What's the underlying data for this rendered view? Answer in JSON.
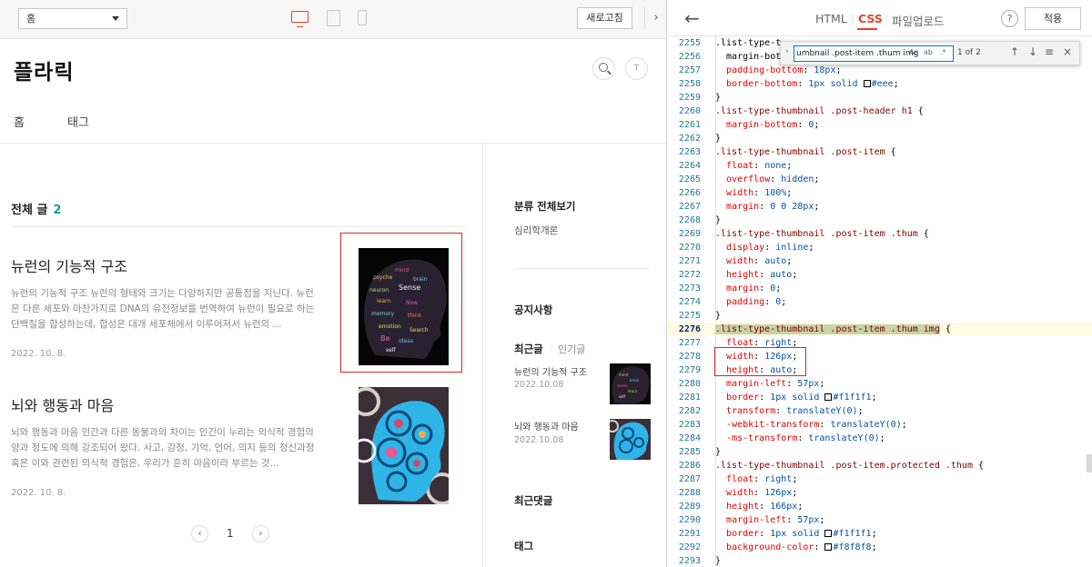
{
  "preview": {
    "page_select": "홈",
    "refresh_label": "새로고침",
    "collapse_label": "›",
    "blog_title": "플라릭",
    "nav": [
      "홈",
      "태그"
    ],
    "section_title": "전체 글",
    "section_count": "2",
    "posts": [
      {
        "title": "뉴런의 기능적 구조",
        "summary": "뉴런의 기능적 구조 뉴런의 형태와 크기는 다양하지만 공통점을 지닌다. 뉴런은 다른 세포와 마찬가지로 DNA의 유전정보를 번역하여 뉴런이 필요로 하는 단백질을 합성하는데, 합성은 대개 세포체에서 이루어져서 뉴런의 ...",
        "date": "2022. 10. 8."
      },
      {
        "title": "뇌와 행동과 마음",
        "summary": "뇌와 행동과 마음 인간과 다른 동물과의 차이는 인간이 누리는 의식적 경험의 양과 정도에 의해 강조되어 왔다. 사고, 감정, 기억, 언어, 의지 등의 정신과정 혹은 이와 관련된 의식적 경험은, 우리가 흔히 마음이라 부르는 것...",
        "date": "2022. 10. 8."
      }
    ],
    "pager": {
      "prev": "‹",
      "current": "1",
      "next": "›"
    },
    "sidebar": {
      "category_title": "분류 전체보기",
      "category_item": "심리학개론",
      "notice_title": "공지사항",
      "recent_tab": "최근글",
      "popular_tab": "인기글",
      "recent_posts": [
        {
          "title": "뉴런의 기능적 구조",
          "date": "2022.10.08"
        },
        {
          "title": "뇌와 행동과 마음",
          "date": "2022.10.08"
        }
      ],
      "comments_title": "최근댓글",
      "tags_title": "태그"
    }
  },
  "editor": {
    "back_icon": "←",
    "tabs": [
      "HTML",
      "CSS",
      "파일업로드"
    ],
    "active_tab": "CSS",
    "help_label": "?",
    "apply_label": "적용",
    "find": {
      "query": "umbnail .post-item .thum img",
      "count": "1 of 2",
      "opt_case": "Aa",
      "opt_word": "ab",
      "opt_regex": ".*"
    },
    "lines": [
      {
        "n": "2255",
        "t": ".list-type-t"
      },
      {
        "n": "2256",
        "t": "  margin-bott"
      },
      {
        "n": "2257",
        "t": "  padding-bottom: 18px;"
      },
      {
        "n": "2258",
        "t": "  border-bottom: 1px solid #eee;"
      },
      {
        "n": "2259",
        "t": "}"
      },
      {
        "n": "2260",
        "t": ".list-type-thumbnail .post-header h1 {"
      },
      {
        "n": "2261",
        "t": "  margin-bottom: 0;"
      },
      {
        "n": "2262",
        "t": "}"
      },
      {
        "n": "2263",
        "t": ".list-type-thumbnail .post-item {"
      },
      {
        "n": "2264",
        "t": "  float: none;"
      },
      {
        "n": "2265",
        "t": "  overflow: hidden;"
      },
      {
        "n": "2266",
        "t": "  width: 100%;"
      },
      {
        "n": "2267",
        "t": "  margin: 0 0 28px;"
      },
      {
        "n": "2268",
        "t": "}"
      },
      {
        "n": "2269",
        "t": ".list-type-thumbnail .post-item .thum {"
      },
      {
        "n": "2270",
        "t": "  display: inline;"
      },
      {
        "n": "2271",
        "t": "  width: auto;"
      },
      {
        "n": "2272",
        "t": "  height: auto;"
      },
      {
        "n": "2273",
        "t": "  margin: 0;"
      },
      {
        "n": "2274",
        "t": "  padding: 0;"
      },
      {
        "n": "2275",
        "t": "}"
      },
      {
        "n": "2276",
        "t": ".list-type-thumbnail .post-item .thum img {"
      },
      {
        "n": "2277",
        "t": "  float: right;"
      },
      {
        "n": "2278",
        "t": "  width: 126px;"
      },
      {
        "n": "2279",
        "t": "  height: auto;"
      },
      {
        "n": "2280",
        "t": "  margin-left: 57px;"
      },
      {
        "n": "2281",
        "t": "  border: 1px solid #f1f1f1;"
      },
      {
        "n": "2282",
        "t": "  transform: translateY(0);"
      },
      {
        "n": "2283",
        "t": "  -webkit-transform: translateY(0);"
      },
      {
        "n": "2284",
        "t": "  -ms-transform: translateY(0);"
      },
      {
        "n": "2285",
        "t": "}"
      },
      {
        "n": "2286",
        "t": ".list-type-thumbnail .post-item.protected .thum {"
      },
      {
        "n": "2287",
        "t": "  float: right;"
      },
      {
        "n": "2288",
        "t": "  width: 126px;"
      },
      {
        "n": "2289",
        "t": "  height: 166px;"
      },
      {
        "n": "2290",
        "t": "  margin-left: 57px;"
      },
      {
        "n": "2291",
        "t": "  border: 1px solid #f1f1f1;"
      },
      {
        "n": "2292",
        "t": "  background-color: #f8f8f8;"
      },
      {
        "n": "2293",
        "t": "}"
      }
    ]
  },
  "colors": {
    "accent": "#e8412c",
    "count": "#00a2a2",
    "annotation": "#d8262c"
  }
}
